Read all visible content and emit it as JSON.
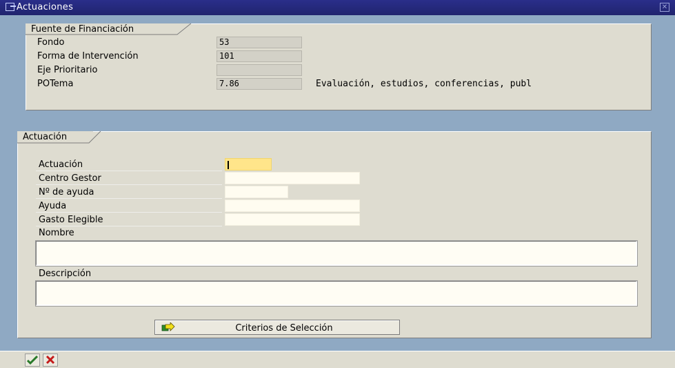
{
  "window": {
    "title": "Actuaciones"
  },
  "fuente": {
    "group_title": "Fuente de Financiación",
    "fields": [
      {
        "label": "Fondo",
        "value": "53",
        "desc": ""
      },
      {
        "label": "Forma de Intervención",
        "value": "101",
        "desc": ""
      },
      {
        "label": "Eje Prioritario",
        "value": "",
        "desc": ""
      },
      {
        "label": "POTema",
        "value": "7.86",
        "desc": "Evaluación, estudios, conferencias, publ"
      }
    ]
  },
  "actuacion": {
    "group_title": "Actuación",
    "fields": [
      {
        "label": "Actuación",
        "value": ""
      },
      {
        "label": "Centro Gestor",
        "value": ""
      },
      {
        "label": "Nº de ayuda",
        "value": ""
      },
      {
        "label": "Ayuda",
        "value": ""
      },
      {
        "label": "Gasto Elegible",
        "value": ""
      }
    ],
    "nombre_label": "Nombre",
    "nombre_value": "",
    "descripcion_label": "Descripción",
    "descripcion_value": "",
    "criterios_button": "Criterios de Selección"
  },
  "icons": {
    "ok": "checkmark-icon",
    "cancel": "cancel-x-icon",
    "criterios": "arrow-right-icon",
    "window": "window-icon",
    "close": "close-icon"
  },
  "colors": {
    "titlebar": "#20246e",
    "background": "#8fa9c3",
    "panel": "#dedcd0",
    "active_input": "#ffe58a"
  }
}
